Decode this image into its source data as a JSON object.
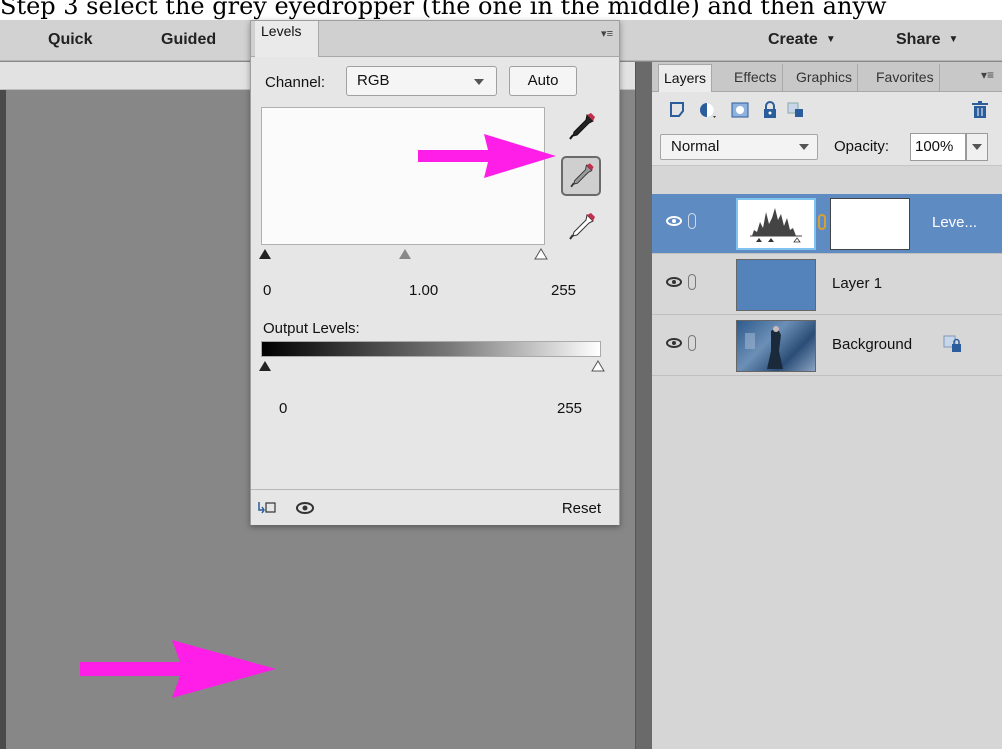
{
  "caption": "Step 3 select the grey eyedropper (the one in the middle) and then anyw",
  "topbar": {
    "quick": "Quick",
    "guided": "Guided",
    "create": "Create",
    "share": "Share"
  },
  "levels": {
    "tab": "Levels",
    "channel_label": "Channel:",
    "channel_value": "RGB",
    "auto_label": "Auto",
    "input_black": "0",
    "input_gamma": "1.00",
    "input_white": "255",
    "output_label": "Output Levels:",
    "output_black": "0",
    "output_white": "255",
    "reset_label": "Reset"
  },
  "layers_panel": {
    "tabs": [
      "Layers",
      "Effects",
      "Graphics",
      "Favorites"
    ],
    "blend_mode": "Normal",
    "opacity_label": "Opacity:",
    "opacity_value": "100%",
    "layers": [
      {
        "name": "Leve...",
        "selected": true
      },
      {
        "name": "Layer 1",
        "selected": false
      },
      {
        "name": "Background",
        "selected": false
      }
    ]
  },
  "colors": {
    "annotation_arrow": "#ff1ee8",
    "selection": "#5f8bc3"
  }
}
